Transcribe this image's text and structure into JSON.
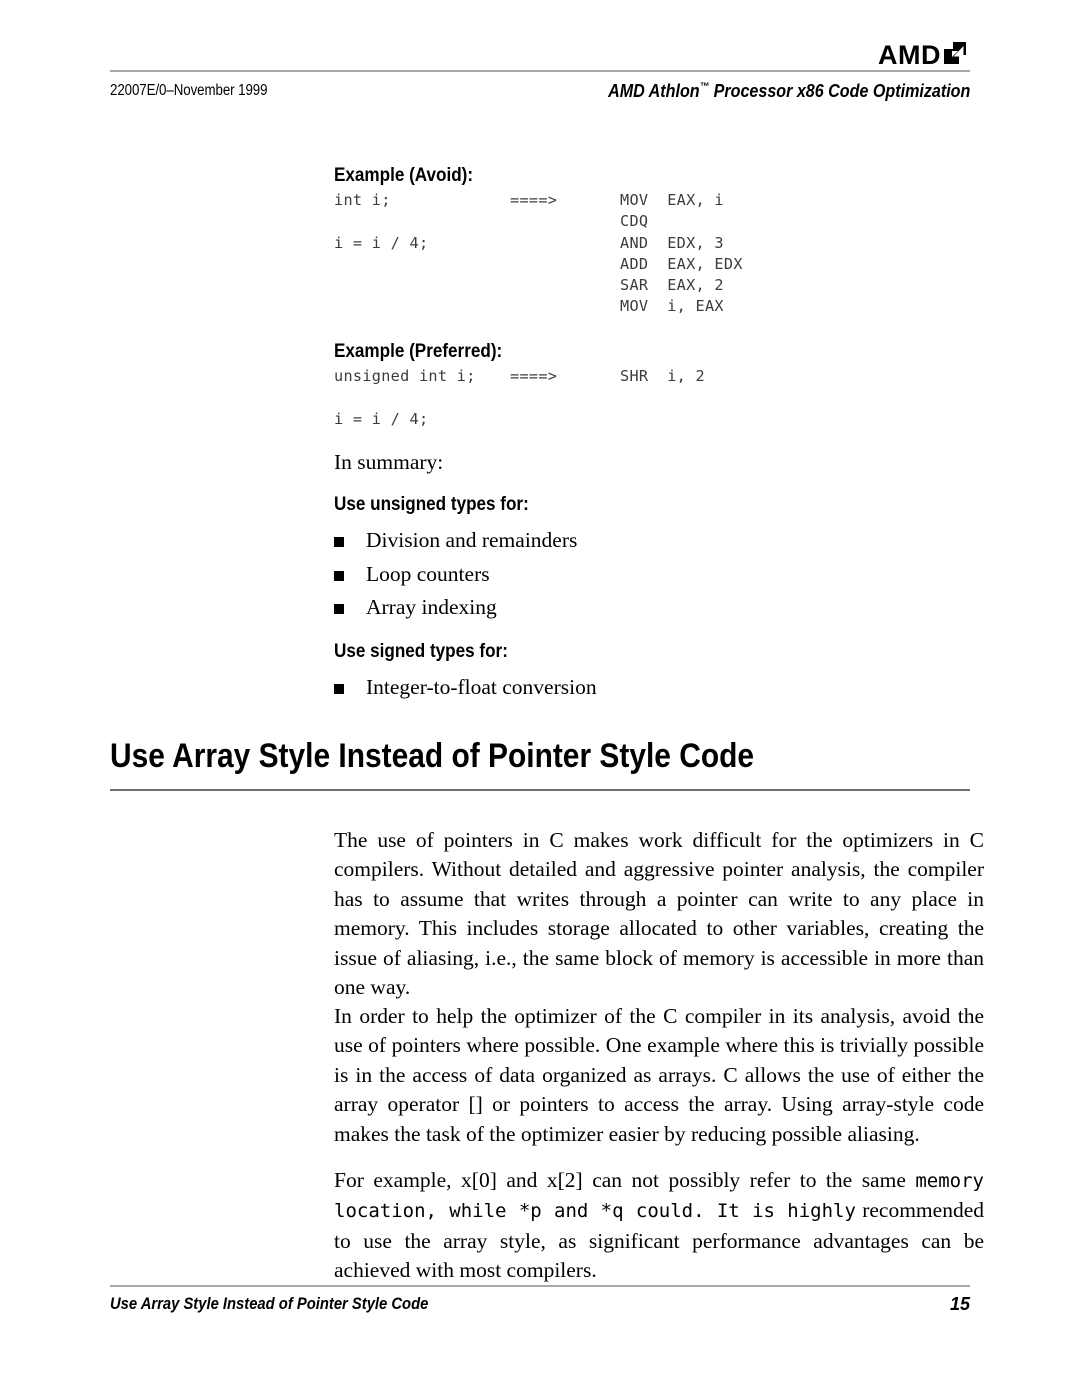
{
  "header": {
    "logo_text": "AMD",
    "logo_icon": "amd-arrow-icon",
    "doc_id": "22007E/0–November 1999",
    "title": "AMD Athlon",
    "title_tm": "™",
    "title_rest": " Processor x86 Code Optimization"
  },
  "examples": [
    {
      "heading": "Example (Avoid):",
      "left": "int i;\n\ni = i / 4;",
      "arrow": "====>",
      "right": "MOV  EAX, i\nCDQ\nAND  EDX, 3\nADD  EAX, EDX\nSAR  EAX, 2\nMOV  i, EAX"
    },
    {
      "heading": "Example (Preferred):",
      "left": "unsigned int i;\n\ni = i / 4;",
      "arrow": "====>",
      "right": "SHR  i, 2"
    }
  ],
  "summary": {
    "intro": "In summary:",
    "unsigned_heading": "Use unsigned types for:",
    "unsigned_items": [
      "Division and remainders",
      "Loop counters",
      "Array indexing"
    ],
    "signed_heading": "Use signed types for:",
    "signed_items": [
      "Integer-to-float conversion"
    ]
  },
  "chapter": {
    "title": "Use Array Style Instead of Pointer Style Code"
  },
  "paragraphs": [
    "The use of pointers in C makes work difficult for the optimizers in C compilers. Without detailed and aggressive pointer analysis, the compiler has to assume that writes through a pointer can write to any place in memory. This includes storage allocated to other variables, creating the issue of aliasing, i.e., the same block of memory is accessible in more than one way.",
    "In order to help the optimizer of the C compiler in its analysis, avoid the use of pointers where possible. One example where this is trivially possible is in the access of data organized as arrays. C allows the use of either the array operator [] or pointers to access the array. Using array-style code makes the task of the optimizer easier by reducing possible aliasing."
  ],
  "paragraph3": {
    "part1": "For example, x[0] and x[2] can not possibly refer to the same ",
    "mono": "memory location, while *p and *q could. It is highly",
    "part2": " recommended to use the array style, as significant performance advantages can be achieved with most compilers."
  },
  "footer": {
    "title": "Use Array Style Instead of Pointer Style Code",
    "page_number": "15"
  }
}
